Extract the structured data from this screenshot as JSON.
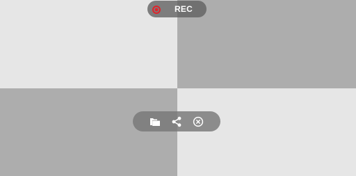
{
  "recording": {
    "label": "REC",
    "indicator_icon": "record-icon",
    "indicator_color": "#e0242b"
  },
  "toolbar": {
    "buttons": [
      {
        "icon": "folder-icon",
        "label": ""
      },
      {
        "icon": "share-icon",
        "label": ""
      },
      {
        "icon": "close-circle-icon",
        "label": ""
      }
    ],
    "icon_color": "#ffffff"
  },
  "background": {
    "light_color": "#e6e6e6",
    "dark_color": "#adadad"
  }
}
